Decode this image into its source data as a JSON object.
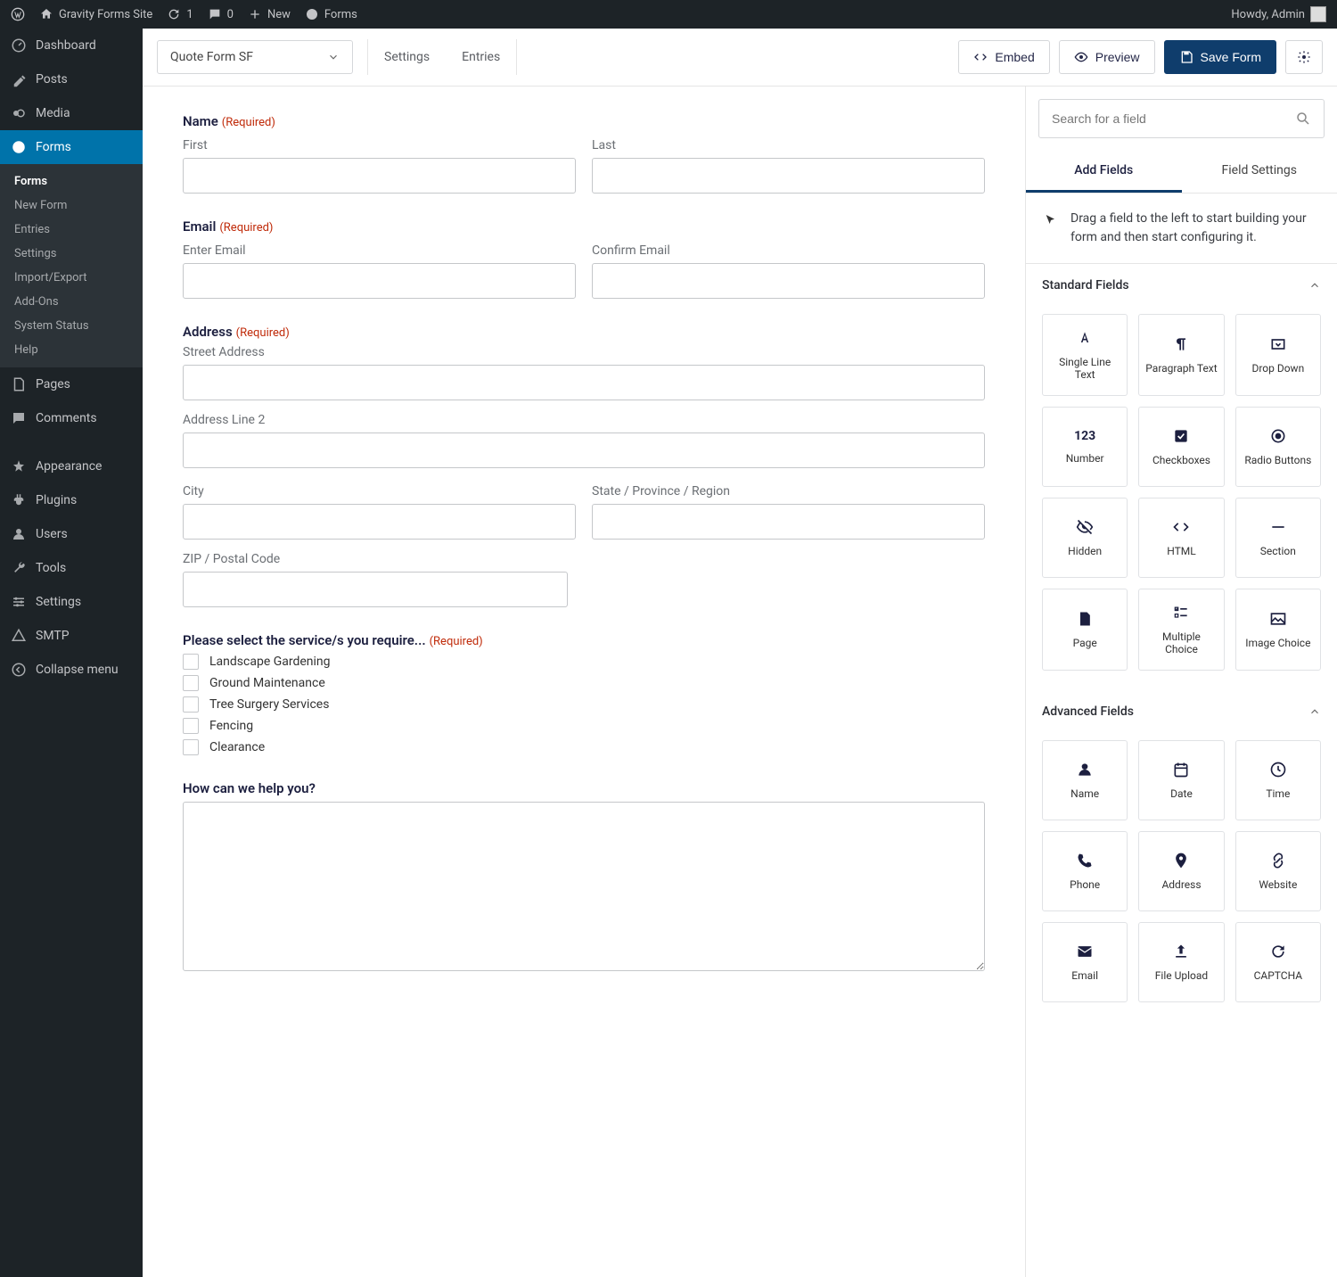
{
  "adminbar": {
    "site_name": "Gravity Forms Site",
    "updates": "1",
    "comments": "0",
    "new_label": "New",
    "forms_label": "Forms",
    "howdy": "Howdy, Admin"
  },
  "sidebar": {
    "dashboard": "Dashboard",
    "posts": "Posts",
    "media": "Media",
    "forms": "Forms",
    "sub": {
      "forms": "Forms",
      "new_form": "New Form",
      "entries": "Entries",
      "settings": "Settings",
      "import_export": "Import/Export",
      "addons": "Add-Ons",
      "system_status": "System Status",
      "help": "Help"
    },
    "pages": "Pages",
    "comments": "Comments",
    "appearance": "Appearance",
    "plugins": "Plugins",
    "users": "Users",
    "tools": "Tools",
    "settings": "Settings",
    "smtp": "SMTP",
    "collapse": "Collapse menu"
  },
  "toolbar": {
    "form_name": "Quote Form SF",
    "settings": "Settings",
    "entries": "Entries",
    "embed": "Embed",
    "preview": "Preview",
    "save": "Save Form"
  },
  "form": {
    "name_label": "Name",
    "required": "(Required)",
    "first": "First",
    "last": "Last",
    "email_label": "Email",
    "enter_email": "Enter Email",
    "confirm_email": "Confirm Email",
    "address_label": "Address",
    "street": "Street Address",
    "line2": "Address Line 2",
    "city": "City",
    "state": "State / Province / Region",
    "zip": "ZIP / Postal Code",
    "services_label": "Please select the service/s you require...",
    "services": [
      "Landscape Gardening",
      "Ground Maintenance",
      "Tree Surgery Services",
      "Fencing",
      "Clearance"
    ],
    "help_label": "How can we help you?"
  },
  "panel": {
    "search_placeholder": "Search for a field",
    "tab_add": "Add Fields",
    "tab_settings": "Field Settings",
    "drag_hint": "Drag a field to the left to start building your form and then start configuring it.",
    "standard_header": "Standard Fields",
    "standard": [
      "Single Line Text",
      "Paragraph Text",
      "Drop Down",
      "Number",
      "Checkboxes",
      "Radio Buttons",
      "Hidden",
      "HTML",
      "Section",
      "Page",
      "Multiple Choice",
      "Image Choice"
    ],
    "advanced_header": "Advanced Fields",
    "advanced": [
      "Name",
      "Date",
      "Time",
      "Phone",
      "Address",
      "Website",
      "Email",
      "File Upload",
      "CAPTCHA"
    ]
  }
}
